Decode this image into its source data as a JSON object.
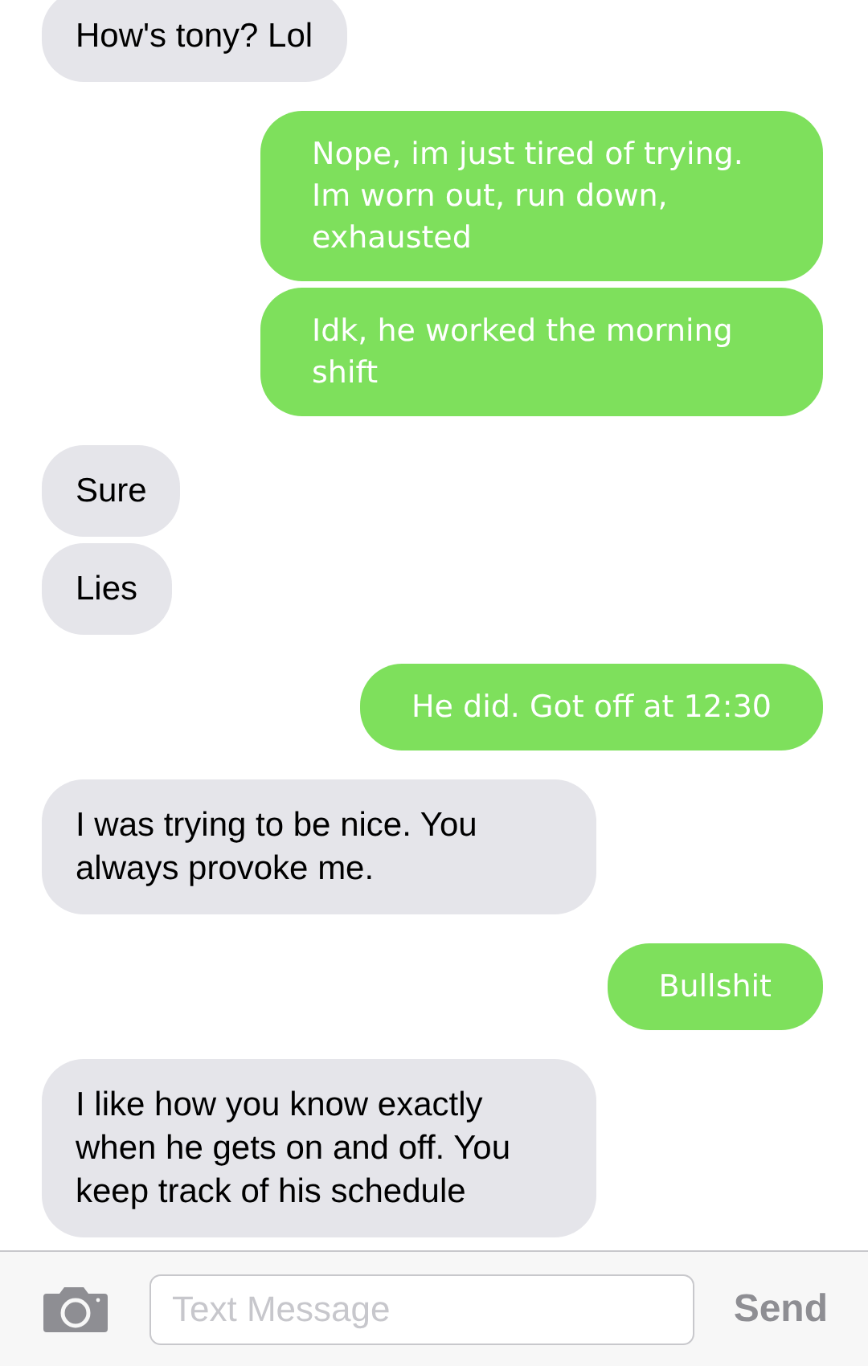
{
  "messages": [
    {
      "kind": "incoming",
      "text": "How's tony? Lol"
    },
    {
      "kind": "outgoing",
      "text": "Nope, im just tired of trying. Im worn out, run down, exhausted"
    },
    {
      "kind": "outgoing",
      "text": "Idk, he worked the morning shift"
    },
    {
      "kind": "incoming",
      "text": "Sure"
    },
    {
      "kind": "incoming",
      "text": "Lies"
    },
    {
      "kind": "outgoing",
      "text": "He did. Got off at 12:30"
    },
    {
      "kind": "incoming",
      "text": "I was trying to be nice. You always provoke me."
    },
    {
      "kind": "outgoing",
      "text": "Bullshit"
    },
    {
      "kind": "incoming",
      "text": "I like how you know exactly when he gets on and off. You keep track of his schedule"
    }
  ],
  "composer": {
    "placeholder": "Text Message",
    "send": "Send"
  }
}
